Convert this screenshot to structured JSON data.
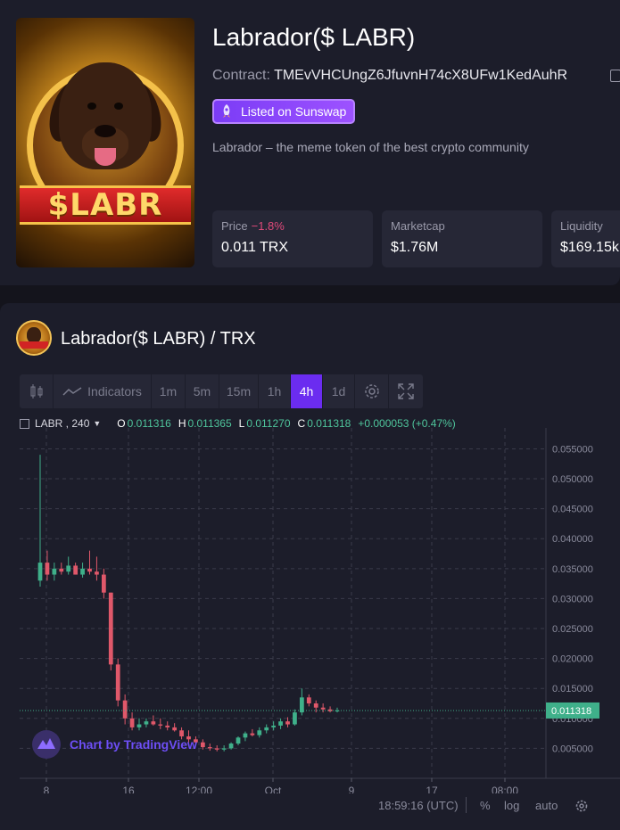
{
  "token": {
    "title": "Labrador($ LABR)",
    "contract_label": "Contract:",
    "contract_address": "TMEvVHCUngZ6JfuvnH74cX8UFw1KedAuhR",
    "listed_badge": "Listed on Sunswap",
    "description": "Labrador – the meme token of the best crypto community",
    "logo_text": "$LABR",
    "stats": [
      {
        "label": "Price",
        "change": "−1.8%",
        "value": "0.011 TRX"
      },
      {
        "label": "Marketcap",
        "change": "",
        "value": "$1.76M"
      },
      {
        "label": "Liquidity",
        "change": "",
        "value": "$169.15k"
      }
    ],
    "colors": {
      "accent": "#7b3cf6",
      "negative": "#e0497a",
      "positive": "#4fc59c"
    }
  },
  "chart_section": {
    "pair_title": "Labrador($ LABR) / TRX",
    "toolbar": {
      "candles_icon": "candles-icon",
      "indicators_label": "Indicators",
      "intervals": [
        "1m",
        "5m",
        "15m",
        "1h",
        "4h",
        "1d"
      ],
      "active_interval": "4h",
      "settings_icon": "gear-icon",
      "fullscreen_icon": "fullscreen-icon"
    },
    "legend": {
      "symbol": "LABR , 240",
      "o_label": "O",
      "o": "0.011316",
      "h_label": "H",
      "h": "0.011365",
      "l_label": "L",
      "l": "0.011270",
      "c_label": "C",
      "c": "0.011318",
      "change": "+0.000053 (+0.47%)"
    },
    "watermark": "Chart by TradingView",
    "bottom": {
      "time": "18:59:16 (UTC)",
      "percent": "%",
      "log": "log",
      "auto": "auto"
    }
  },
  "chart_data": {
    "type": "candlestick",
    "title": "",
    "xlabel": "",
    "ylabel": "",
    "x_ticks": [
      "8",
      "16",
      "12:00",
      "Oct",
      "9",
      "17",
      "08:00"
    ],
    "y_ticks": [
      "0.005000",
      "0.010000",
      "0.015000",
      "0.020000",
      "0.025000",
      "0.030000",
      "0.035000",
      "0.040000",
      "0.045000",
      "0.050000",
      "0.055000"
    ],
    "ylim": [
      0.0,
      0.057
    ],
    "last_price_label": "0.011318",
    "last_price": 0.011318,
    "grid": true,
    "candles": [
      {
        "o": 0.033,
        "h": 0.054,
        "l": 0.032,
        "c": 0.036
      },
      {
        "o": 0.036,
        "h": 0.038,
        "l": 0.033,
        "c": 0.034
      },
      {
        "o": 0.034,
        "h": 0.036,
        "l": 0.033,
        "c": 0.035
      },
      {
        "o": 0.035,
        "h": 0.036,
        "l": 0.034,
        "c": 0.0345
      },
      {
        "o": 0.0345,
        "h": 0.037,
        "l": 0.034,
        "c": 0.0355
      },
      {
        "o": 0.0355,
        "h": 0.036,
        "l": 0.034,
        "c": 0.034
      },
      {
        "o": 0.034,
        "h": 0.036,
        "l": 0.0335,
        "c": 0.035
      },
      {
        "o": 0.035,
        "h": 0.038,
        "l": 0.034,
        "c": 0.0345
      },
      {
        "o": 0.0345,
        "h": 0.037,
        "l": 0.033,
        "c": 0.034
      },
      {
        "o": 0.034,
        "h": 0.035,
        "l": 0.03,
        "c": 0.031
      },
      {
        "o": 0.031,
        "h": 0.031,
        "l": 0.018,
        "c": 0.019
      },
      {
        "o": 0.019,
        "h": 0.02,
        "l": 0.012,
        "c": 0.013
      },
      {
        "o": 0.013,
        "h": 0.014,
        "l": 0.009,
        "c": 0.01
      },
      {
        "o": 0.01,
        "h": 0.011,
        "l": 0.008,
        "c": 0.0085
      },
      {
        "o": 0.0085,
        "h": 0.01,
        "l": 0.008,
        "c": 0.009
      },
      {
        "o": 0.009,
        "h": 0.01,
        "l": 0.0085,
        "c": 0.0095
      },
      {
        "o": 0.0095,
        "h": 0.0105,
        "l": 0.0088,
        "c": 0.009
      },
      {
        "o": 0.009,
        "h": 0.01,
        "l": 0.0082,
        "c": 0.0088
      },
      {
        "o": 0.0088,
        "h": 0.0095,
        "l": 0.008,
        "c": 0.0085
      },
      {
        "o": 0.0085,
        "h": 0.0092,
        "l": 0.0078,
        "c": 0.008
      },
      {
        "o": 0.008,
        "h": 0.0085,
        "l": 0.0065,
        "c": 0.007
      },
      {
        "o": 0.007,
        "h": 0.008,
        "l": 0.006,
        "c": 0.0065
      },
      {
        "o": 0.0065,
        "h": 0.007,
        "l": 0.0055,
        "c": 0.006
      },
      {
        "o": 0.006,
        "h": 0.0065,
        "l": 0.0048,
        "c": 0.0052
      },
      {
        "o": 0.0052,
        "h": 0.0058,
        "l": 0.0046,
        "c": 0.005
      },
      {
        "o": 0.005,
        "h": 0.0055,
        "l": 0.0045,
        "c": 0.0048
      },
      {
        "o": 0.0048,
        "h": 0.0055,
        "l": 0.0045,
        "c": 0.005
      },
      {
        "o": 0.005,
        "h": 0.006,
        "l": 0.0048,
        "c": 0.0058
      },
      {
        "o": 0.0058,
        "h": 0.007,
        "l": 0.0055,
        "c": 0.0068
      },
      {
        "o": 0.0068,
        "h": 0.0078,
        "l": 0.0062,
        "c": 0.0075
      },
      {
        "o": 0.0075,
        "h": 0.0082,
        "l": 0.007,
        "c": 0.0072
      },
      {
        "o": 0.0072,
        "h": 0.0085,
        "l": 0.0068,
        "c": 0.008
      },
      {
        "o": 0.008,
        "h": 0.009,
        "l": 0.0075,
        "c": 0.0085
      },
      {
        "o": 0.0085,
        "h": 0.0095,
        "l": 0.008,
        "c": 0.0088
      },
      {
        "o": 0.0088,
        "h": 0.01,
        "l": 0.0082,
        "c": 0.0095
      },
      {
        "o": 0.0095,
        "h": 0.0102,
        "l": 0.0085,
        "c": 0.009
      },
      {
        "o": 0.009,
        "h": 0.0115,
        "l": 0.0088,
        "c": 0.011
      },
      {
        "o": 0.011,
        "h": 0.015,
        "l": 0.0105,
        "c": 0.0135
      },
      {
        "o": 0.0135,
        "h": 0.014,
        "l": 0.012,
        "c": 0.0125
      },
      {
        "o": 0.0125,
        "h": 0.013,
        "l": 0.011,
        "c": 0.0118
      },
      {
        "o": 0.0118,
        "h": 0.0125,
        "l": 0.011,
        "c": 0.0115
      },
      {
        "o": 0.0115,
        "h": 0.012,
        "l": 0.011,
        "c": 0.0112
      },
      {
        "o": 0.0112,
        "h": 0.0118,
        "l": 0.011,
        "c": 0.011318
      }
    ]
  }
}
